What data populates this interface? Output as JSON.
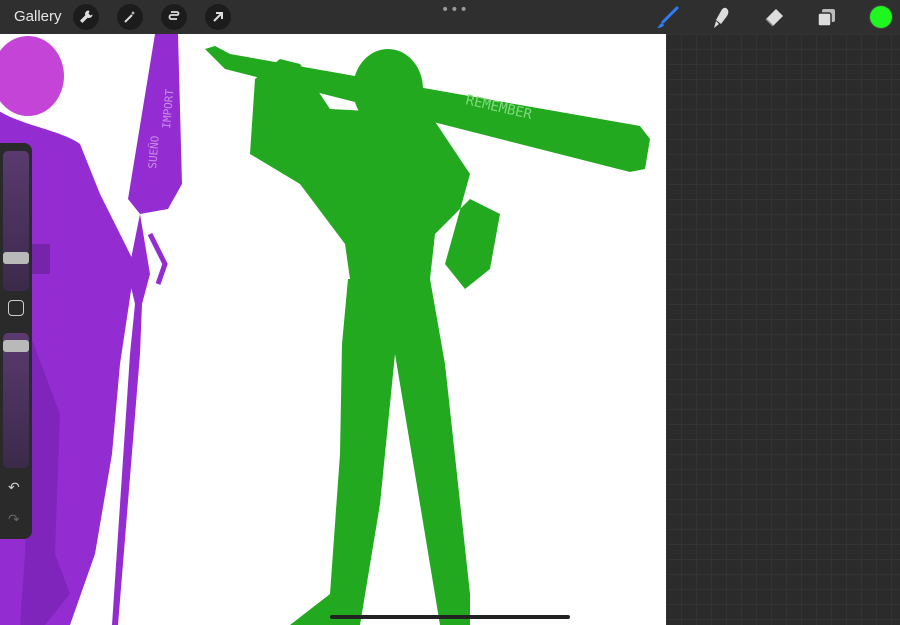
{
  "topbar": {
    "gallery_label": "Gallery",
    "left_tools": [
      "wrench-icon",
      "magic-wand-icon",
      "selection-icon",
      "transform-arrow-icon"
    ],
    "more_label": "•••",
    "right_tools": [
      "brush-icon",
      "smudge-icon",
      "eraser-icon",
      "layers-icon"
    ],
    "active_color": "#1ff51f"
  },
  "canvas": {
    "lettering": [
      "SUEÑO",
      "IMPORT",
      "REMEMBER"
    ]
  },
  "sidebar": {
    "undo_glyph": "↶",
    "redo_glyph": "↷"
  },
  "colors": {
    "toolbar_bg": "#2f2f2f",
    "canvas_bg": "#ffffff",
    "purple": "#8b1fd0",
    "green": "#22a81f"
  }
}
